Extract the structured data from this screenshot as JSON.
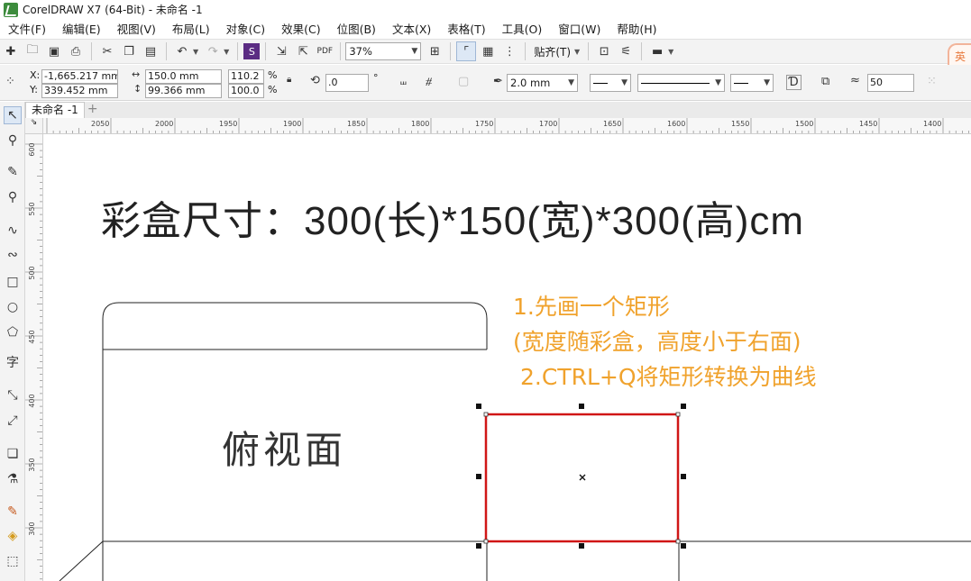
{
  "window": {
    "title": "CorelDRAW X7 (64-Bit) - 未命名 -1"
  },
  "menu": [
    "文件(F)",
    "编辑(E)",
    "视图(V)",
    "布局(L)",
    "对象(C)",
    "效果(C)",
    "位图(B)",
    "文本(X)",
    "表格(T)",
    "工具(O)",
    "窗口(W)",
    "帮助(H)"
  ],
  "toolbar": {
    "zoom": "37%",
    "snap_label": "贴齐(T)",
    "ime_label": "英"
  },
  "properties": {
    "x_label": "X:",
    "x_value": "-1,665.217 mm",
    "y_label": "Y:",
    "y_value": "339.452 mm",
    "width_value": "150.0 mm",
    "height_value": "99.366 mm",
    "scale_x": "110.2",
    "scale_y": "100.0",
    "percent_x": "%",
    "percent_y": "%",
    "rotation": ".0",
    "degree": "°",
    "outline_width": "2.0 mm",
    "curve_smoothing": "50"
  },
  "document_tab": "未命名 -1",
  "ruler": {
    "horizontal": [
      "2050",
      "2000",
      "1950",
      "1900",
      "1850",
      "1800",
      "1750",
      "1700",
      "1650",
      "1600",
      "1550",
      "1500",
      "1450",
      "1400"
    ],
    "vertical": [
      "600",
      "550",
      "500",
      "450",
      "400",
      "350",
      "300"
    ]
  },
  "canvas": {
    "heading": "彩盒尺寸：300(长)*150(宽)*300(高)cm",
    "note_line1": "1.先画一个矩形",
    "note_line2": "(宽度随彩盒，高度小于右面)",
    "note_line3": "2.CTRL+Q将矩形转换为曲线",
    "top_face_label": "俯视面"
  },
  "colors": {
    "note": "#f0a22c",
    "selection": "#d01616",
    "ink": "#222222"
  },
  "icons": {
    "toolbar": [
      "new-icon",
      "open-icon",
      "save-icon",
      "print-icon",
      "cut-icon",
      "copy-icon",
      "paste-icon",
      "undo-icon",
      "redo-icon",
      "search-content-icon",
      "import-icon",
      "export-icon",
      "publish-pdf-icon",
      "fullscreen-icon",
      "rulers-icon",
      "grid-icon",
      "guidelines-icon",
      "welcome-icon",
      "options-icon",
      "launch-icon"
    ],
    "tools": [
      "pick-tool-icon",
      "shape-tool-icon",
      "crop-tool-icon",
      "zoom-tool-icon",
      "freehand-tool-icon",
      "artistic-media-icon",
      "rectangle-tool-icon",
      "ellipse-tool-icon",
      "polygon-tool-icon",
      "text-tool-icon",
      "parallel-dimension-icon",
      "connector-tool-icon",
      "drop-shadow-icon",
      "transparency-icon",
      "eyedropper-icon",
      "interactive-fill-icon",
      "smart-fill-icon"
    ]
  }
}
